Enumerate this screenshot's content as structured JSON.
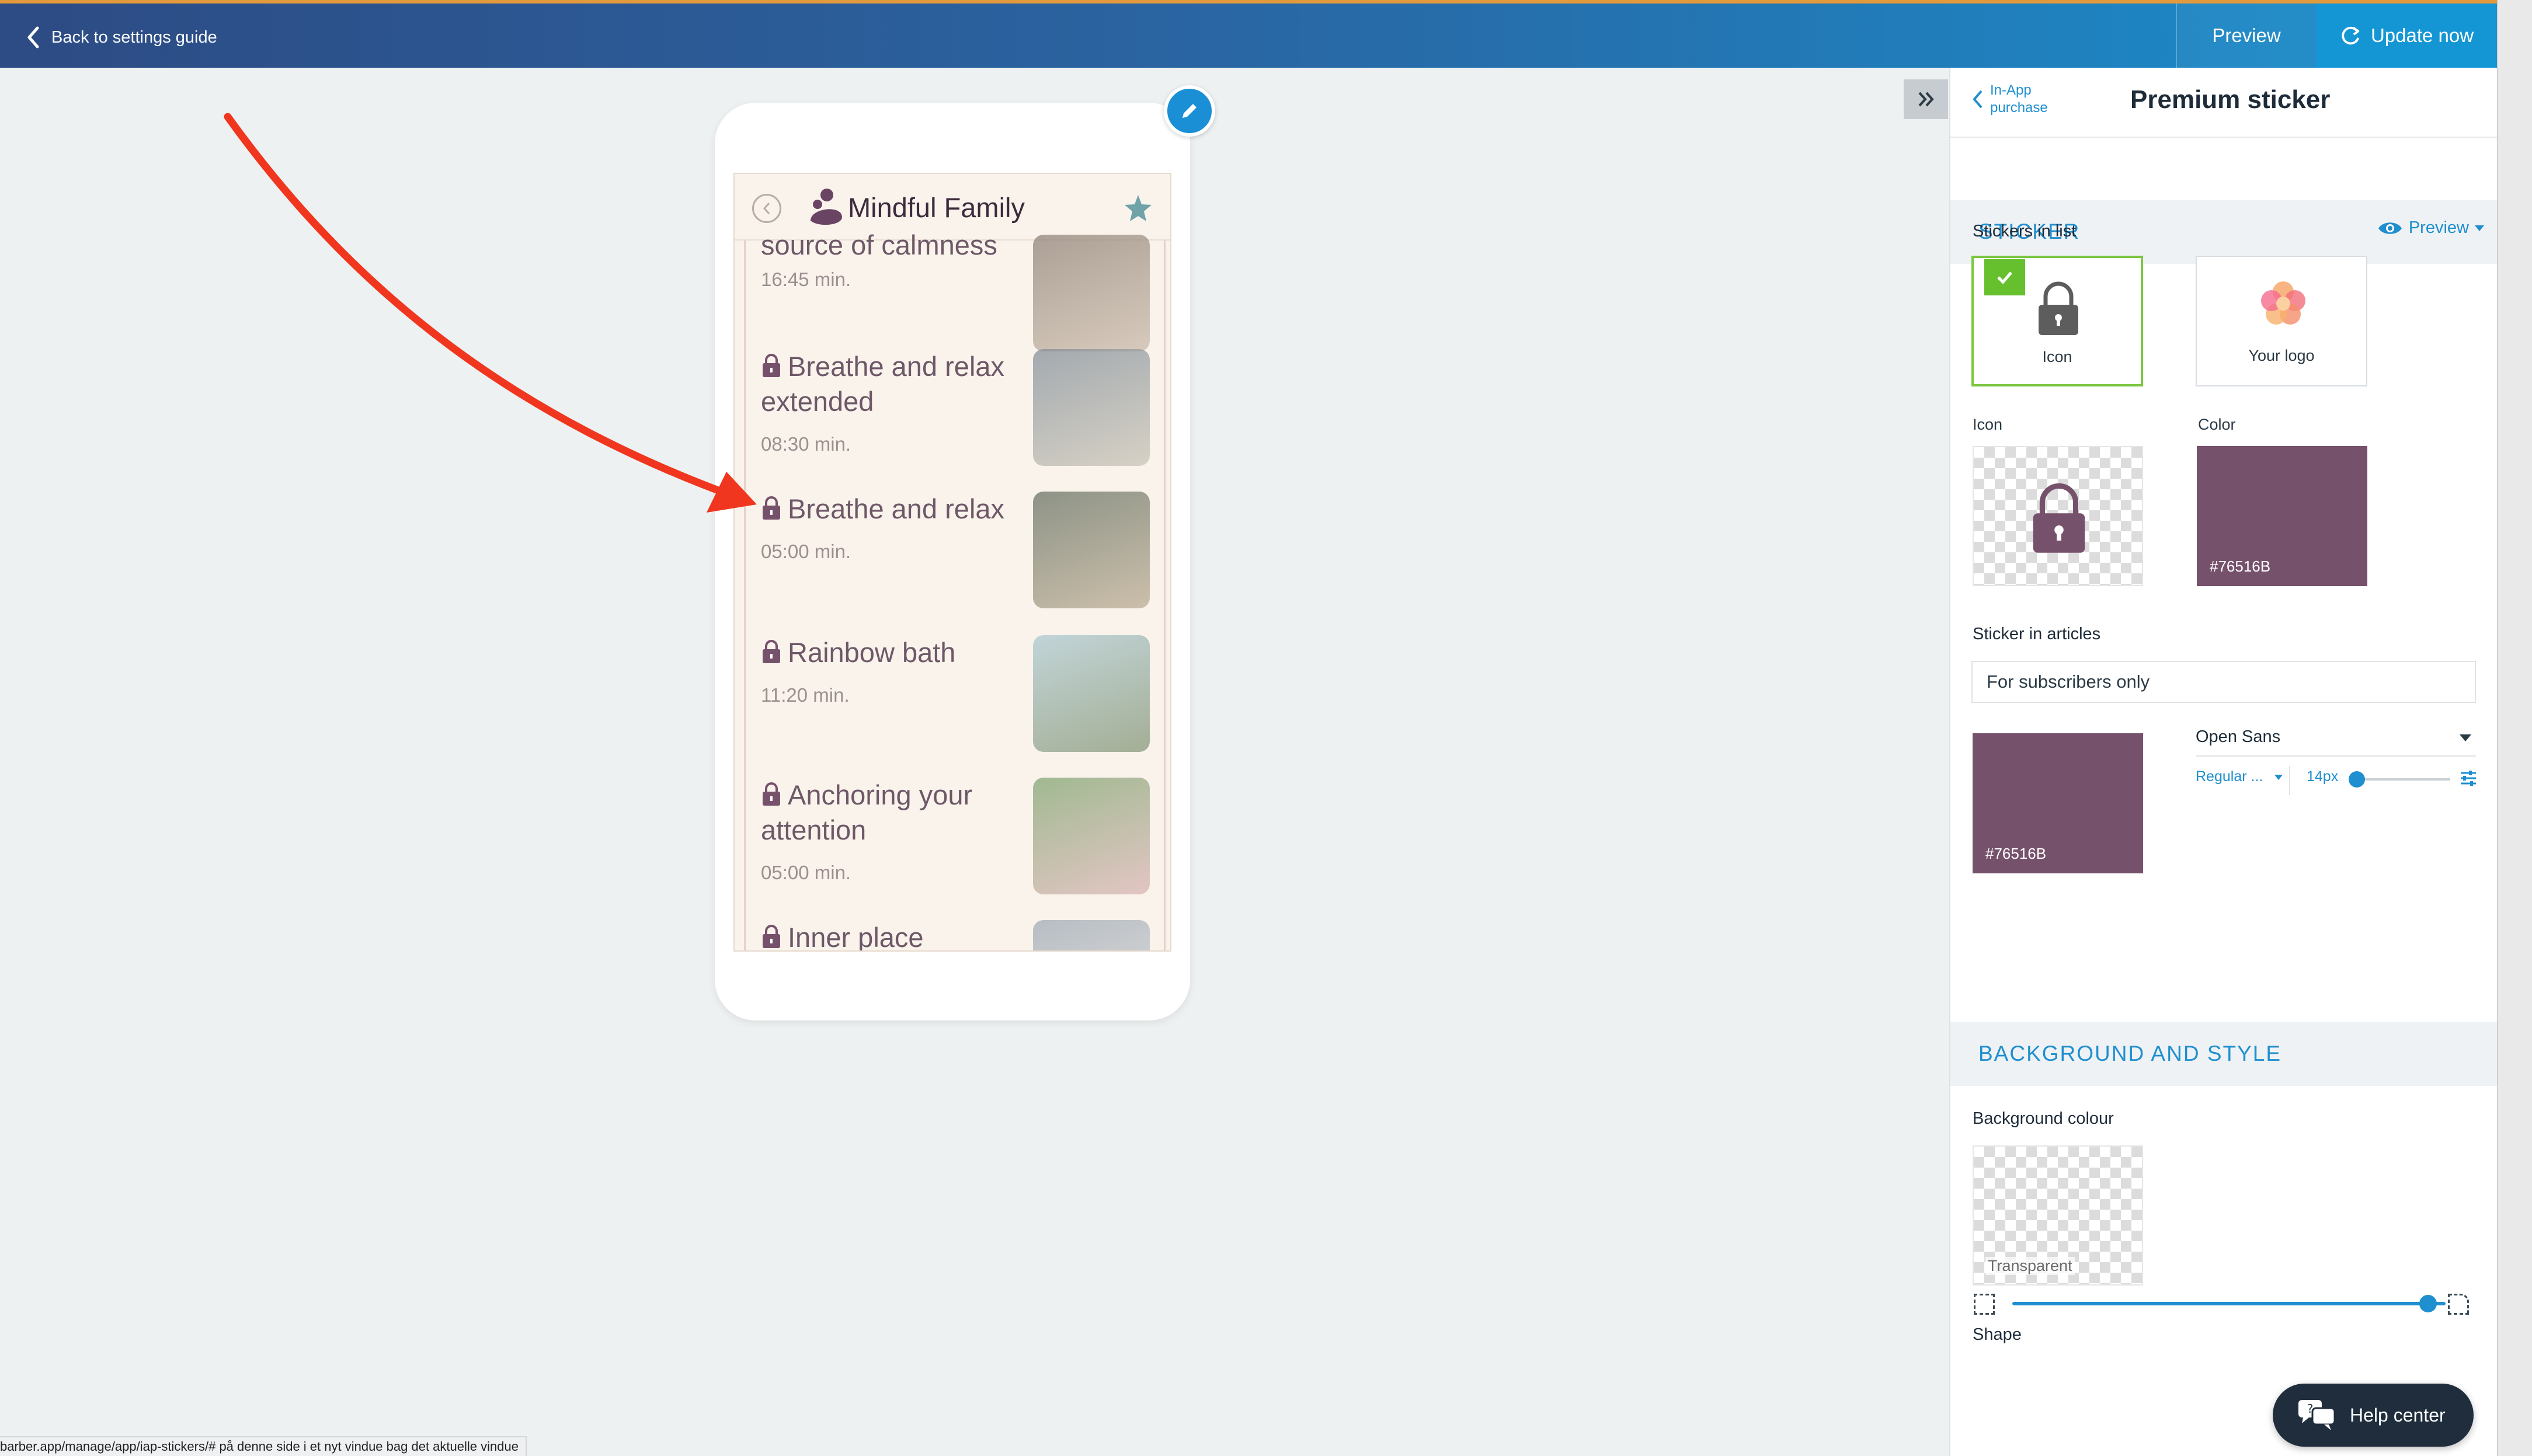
{
  "topbar": {
    "back_label": "Back to settings guide",
    "preview_label": "Preview",
    "update_label": "Update now"
  },
  "app_preview": {
    "title": "Mindful Family",
    "items": [
      {
        "title": "source of calmness",
        "time": "16:45 min.",
        "locked": false,
        "thumb_colors": [
          "#8a7b70",
          "#c9b9a8"
        ]
      },
      {
        "title": "Breathe and relax extended",
        "time": "08:30 min.",
        "locked": true,
        "thumb_colors": [
          "#7d8a95",
          "#c8c2b4"
        ]
      },
      {
        "title": "Breathe and relax",
        "time": "05:00 min.",
        "locked": true,
        "thumb_colors": [
          "#5f6a5b",
          "#b9a98f"
        ]
      },
      {
        "title": "Rainbow bath",
        "time": "11:20 min.",
        "locked": true,
        "thumb_colors": [
          "#a9c7cf",
          "#7f9170"
        ]
      },
      {
        "title": "Anchoring your attention",
        "time": "05:00 min.",
        "locked": true,
        "thumb_colors": [
          "#7aa06a",
          "#d9b2b2"
        ]
      },
      {
        "title": "Inner place",
        "time": "",
        "locked": true,
        "thumb_colors": [
          "#9aa6b2",
          "#d8d8d8"
        ]
      }
    ]
  },
  "panel": {
    "back_label": "In-App purchase",
    "title": "Premium sticker",
    "sticker_section": {
      "heading": "STICKER",
      "preview_label": "Preview",
      "stickers_in_list_label": "Stickers in list",
      "options": [
        {
          "label": "Icon",
          "selected": true
        },
        {
          "label": "Your logo",
          "selected": false
        }
      ],
      "icon_label": "Icon",
      "color_label": "Color",
      "icon_color_hex": "#76516B",
      "sticker_in_articles_label": "Sticker in articles",
      "articles_value": "For subscribers only",
      "text_color_hex": "#76516B",
      "font_family": "Open Sans",
      "font_weight": "Regular ...",
      "font_size": "14px"
    },
    "background_section": {
      "heading": "BACKGROUND AND STYLE",
      "bg_colour_label": "Background colour",
      "bg_colour_value": "Transparent",
      "shape_label": "Shape",
      "shape_level": 0.96
    }
  },
  "help_center_label": "Help center",
  "status_url": "barber.app/manage/app/iap-stickers/# på denne side i et nyt vindue bag det aktuelle vindue",
  "colors": {
    "accent": "#1F8FCF",
    "sticker": "#76516B",
    "selected_border": "#7CC641",
    "arrow": "#F0361E"
  }
}
